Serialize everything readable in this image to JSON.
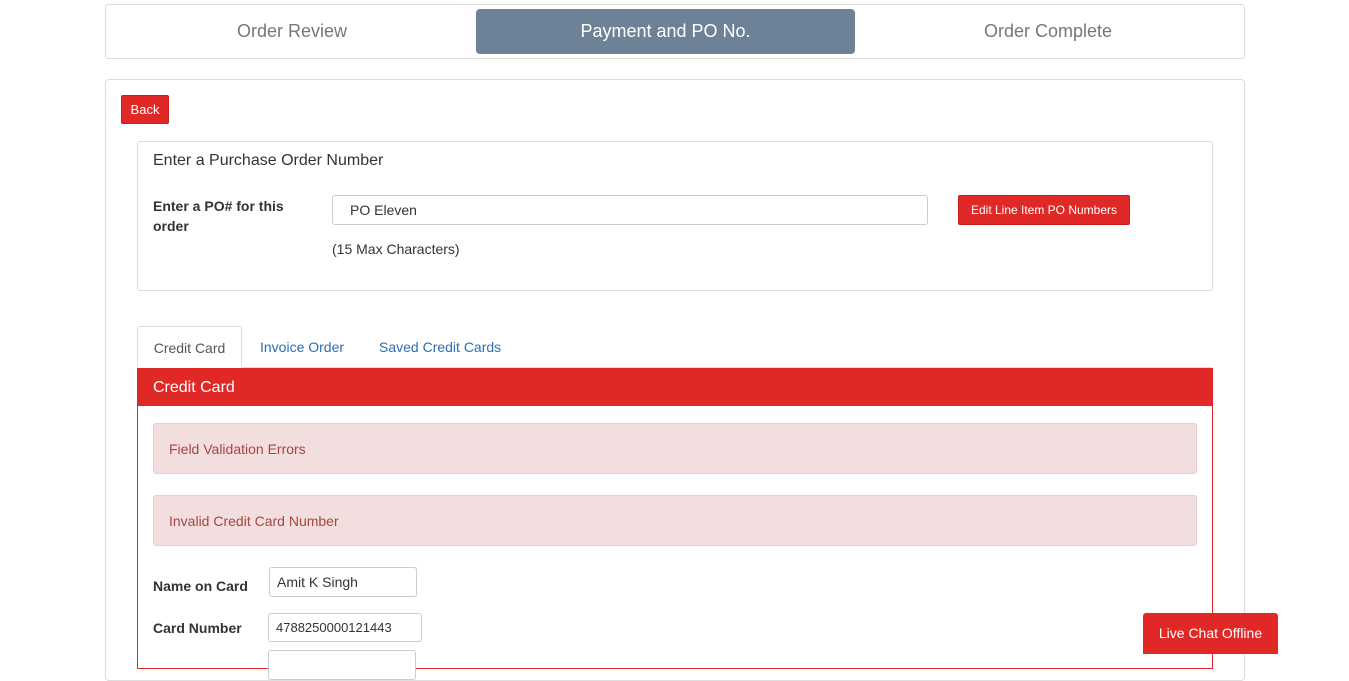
{
  "steps": {
    "review": "Order Review",
    "payment": "Payment and PO No.",
    "complete": "Order Complete"
  },
  "back_label": "Back",
  "po": {
    "title": "Enter a Purchase Order Number",
    "label": "Enter a PO# for this order",
    "value": "PO Eleven",
    "edit_button": "Edit Line Item PO Numbers",
    "hint": "(15 Max Characters)"
  },
  "tabs": {
    "credit_card": "Credit Card",
    "invoice": "Invoice Order",
    "saved": "Saved Credit Cards"
  },
  "credit_card": {
    "header": "Credit Card",
    "alert_1": "Field Validation Errors",
    "alert_2": "Invalid Credit Card Number",
    "name_label": "Name on Card",
    "name_value": "Amit K Singh",
    "number_label": "Card Number",
    "number_value": "4788250000121443"
  },
  "chat_label": "Live Chat Offline",
  "colors": {
    "accent_red": "#e02827",
    "active_step": "#6d8296",
    "alert_bg": "#f2dede",
    "alert_text": "#a94442",
    "link_blue": "#2a6fb5"
  }
}
